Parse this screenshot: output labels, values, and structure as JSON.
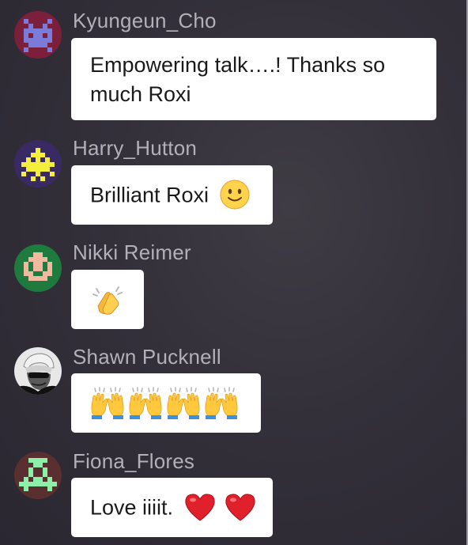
{
  "chat": {
    "messages": [
      {
        "username": "Kyungeun_Cho",
        "text": "Empowering talk….! Thanks so much Roxi",
        "avatar_icon": "pixel-invader-red-icon",
        "avatar_colors": {
          "bg": "#7b1f3a",
          "fg": "#7b7bd9"
        }
      },
      {
        "username": "Harry_Hutton",
        "text": "Brilliant Roxi",
        "emoji": "slightly-smiling-face-emoji",
        "avatar_icon": "pixel-invader-yellow-icon",
        "avatar_colors": {
          "bg": "#3a2a63",
          "fg": "#f5ef3b"
        }
      },
      {
        "username": "Nikki Reimer",
        "text": "",
        "emoji": "clapping-hands-emoji",
        "avatar_icon": "pixel-face-green-icon",
        "avatar_colors": {
          "bg": "#1f7a3d",
          "fg": "#f0b9a0"
        }
      },
      {
        "username": "Shawn Pucknell",
        "text": "",
        "emoji": "raising-hands-emoji",
        "emoji_count": 4,
        "avatar_icon": "photo-person-bw-icon",
        "avatar_colors": {
          "bg": "#e8e8e8",
          "fg": "#1a1a1a"
        }
      },
      {
        "username": "Fiona_Flores",
        "text": "Love iiiit.",
        "emoji": "red-heart-emoji",
        "emoji_count": 2,
        "avatar_icon": "pixel-alien-green-icon",
        "avatar_colors": {
          "bg": "#5a2f2f",
          "fg": "#8cf0a8"
        }
      }
    ]
  }
}
